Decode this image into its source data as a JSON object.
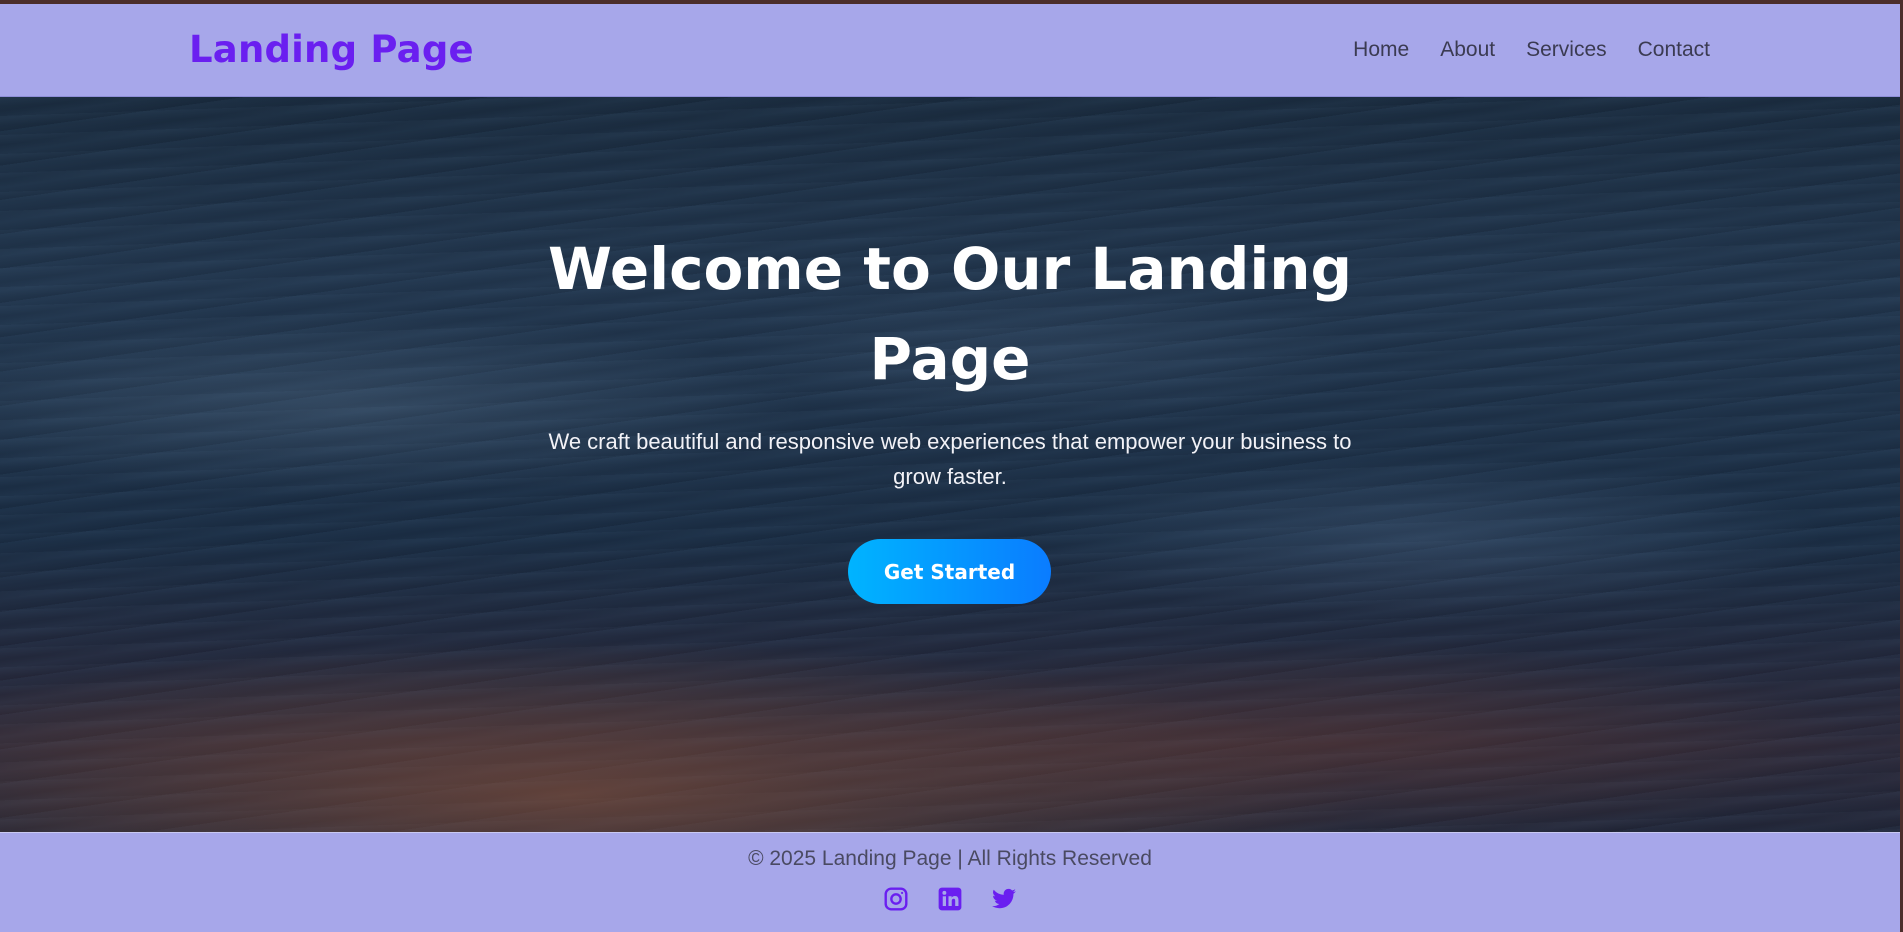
{
  "header": {
    "brand": "Landing Page",
    "nav": [
      {
        "label": "Home"
      },
      {
        "label": "About"
      },
      {
        "label": "Services"
      },
      {
        "label": "Contact"
      }
    ]
  },
  "hero": {
    "title": "Welcome to Our Landing Page",
    "subtitle": "We craft beautiful and responsive web experiences that empower your business to grow faster.",
    "cta_label": "Get Started"
  },
  "footer": {
    "copyright": "© 2025 Landing Page | All Rights Reserved",
    "social": [
      {
        "icon": "instagram-icon"
      },
      {
        "icon": "linkedin-icon"
      },
      {
        "icon": "twitter-icon"
      }
    ]
  },
  "colors": {
    "accent": "#6a1ff0",
    "navbar_bg": "#a7a7ea",
    "cta_start": "#00b4ff",
    "cta_end": "#0a7cff"
  }
}
